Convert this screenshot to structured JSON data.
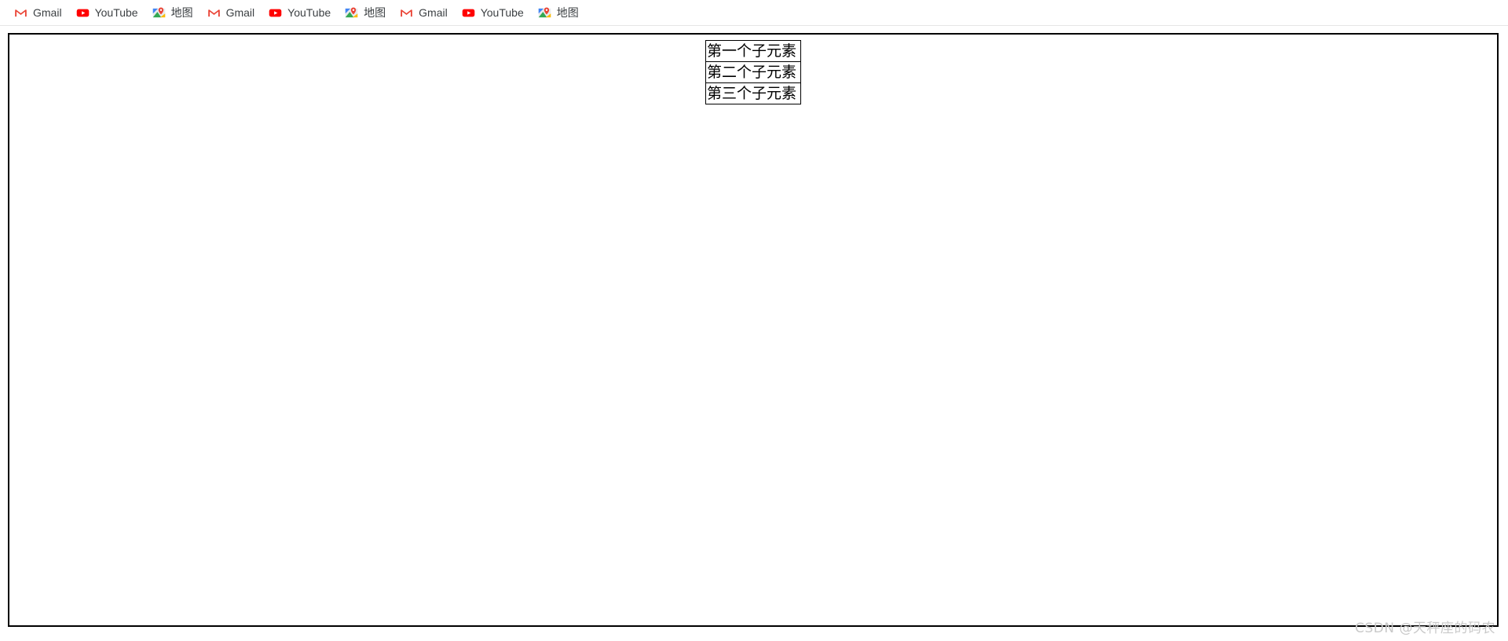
{
  "bookmarks_bar": {
    "items": [
      {
        "label": "Gmail",
        "icon": "gmail-icon"
      },
      {
        "label": "YouTube",
        "icon": "youtube-icon"
      },
      {
        "label": "地图",
        "icon": "maps-icon"
      },
      {
        "label": "Gmail",
        "icon": "gmail-icon"
      },
      {
        "label": "YouTube",
        "icon": "youtube-icon"
      },
      {
        "label": "地图",
        "icon": "maps-icon"
      },
      {
        "label": "Gmail",
        "icon": "gmail-icon"
      },
      {
        "label": "YouTube",
        "icon": "youtube-icon"
      },
      {
        "label": "地图",
        "icon": "maps-icon"
      }
    ]
  },
  "page": {
    "flex_container": {
      "children": [
        {
          "text": "第一个子元素"
        },
        {
          "text": "第二个子元素"
        },
        {
          "text": "第三个子元素"
        }
      ]
    }
  },
  "watermark": {
    "text": "CSDN @天秤座的码农"
  },
  "colors": {
    "gmail_red": "#EA4335",
    "youtube_red": "#FF0000",
    "maps_green": "#34A853",
    "maps_blue": "#4285F4",
    "maps_yellow": "#FBBC04",
    "border_black": "#000000",
    "text_gray": "#3C4043",
    "watermark_gray": "#C9C9C9"
  }
}
